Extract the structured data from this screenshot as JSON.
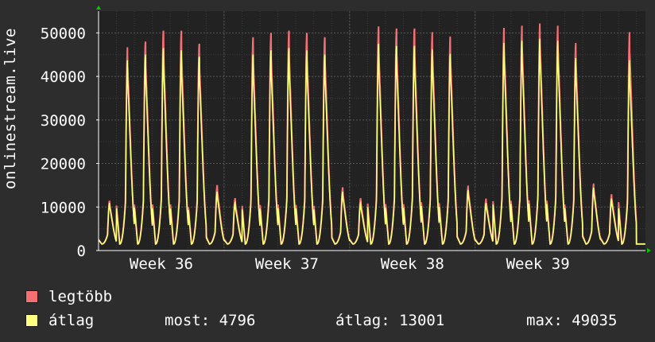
{
  "chart_data": {
    "type": "area",
    "ylabel": "onlinestream.live",
    "ylim": [
      0,
      55000
    ],
    "yticks": [
      0,
      10000,
      20000,
      30000,
      40000,
      50000
    ],
    "yticklabels": [
      "0",
      "10000",
      "20000",
      "30000",
      "40000",
      "50000"
    ],
    "xticklabels": [
      "Week 36",
      "Week 37",
      "Week 38",
      "Week 39"
    ],
    "x_unit": "day",
    "x_range_days": [
      0,
      30.5
    ],
    "week_tick_days": [
      3.5,
      10.5,
      17.5,
      24.5
    ],
    "daily_peaks": {
      "series": [
        {
          "name": "legtöbb",
          "values": [
            11500,
            47000,
            48000,
            50500,
            50500,
            47500,
            15000,
            12000,
            49000,
            50000,
            50500,
            50000,
            49000,
            14500,
            12000,
            51500,
            51000,
            51000,
            50500,
            49500,
            15000,
            12000,
            51500,
            52000,
            52500,
            52000,
            48000,
            15500,
            13000,
            50500
          ]
        },
        {
          "name": "átlag",
          "values": [
            11000,
            44000,
            45000,
            46500,
            46000,
            44500,
            13500,
            11000,
            45000,
            46000,
            46500,
            46000,
            45000,
            13500,
            11000,
            47500,
            47000,
            47000,
            46500,
            45500,
            14000,
            11000,
            48000,
            48500,
            49000,
            48500,
            44500,
            14500,
            12000,
            44000
          ]
        }
      ]
    },
    "daily_min": 1500,
    "grid": true,
    "colors": {
      "legtöbb": "#f56f73",
      "átlag": "#ffff80"
    }
  },
  "legend": {
    "items": [
      {
        "name": "legtöbb",
        "color": "#f56f73"
      },
      {
        "name": "átlag",
        "color": "#ffff80"
      }
    ],
    "stats": {
      "most": "most: 4796",
      "atlag": "átlag: 13001",
      "max": "max: 49035"
    }
  },
  "colors": {
    "background": "#2d2d2d",
    "plot": "#222222",
    "grid_major": "#585858",
    "grid_minor": "#3c3c3c",
    "axis": "#ffffff",
    "text": "#ffffff",
    "arrow": "#00cc00"
  }
}
